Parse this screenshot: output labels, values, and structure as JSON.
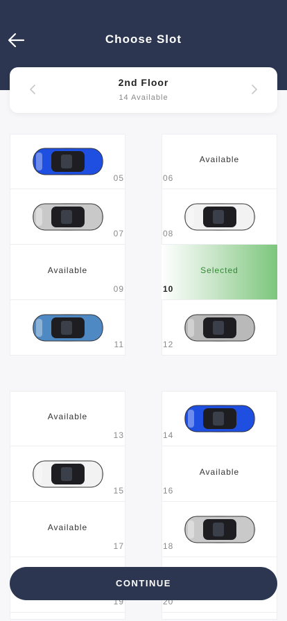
{
  "header": {
    "title": "Choose Slot"
  },
  "floor": {
    "name": "2nd Floor",
    "available": "14 Available"
  },
  "slots": [
    {
      "num": "05",
      "state": "car",
      "color": "#1f4fe0"
    },
    {
      "num": "06",
      "state": "available",
      "label": "Available"
    },
    {
      "num": "07",
      "state": "car",
      "color": "#c9c9c9"
    },
    {
      "num": "08",
      "state": "car",
      "color": "#f2f2f2"
    },
    {
      "num": "09",
      "state": "available",
      "label": "Available"
    },
    {
      "num": "10",
      "state": "selected",
      "label": "Selected"
    },
    {
      "num": "11",
      "state": "car",
      "color": "#4f89c4"
    },
    {
      "num": "12",
      "state": "car",
      "color": "#b9b9b9"
    },
    {
      "num": "13",
      "state": "available",
      "label": "Available"
    },
    {
      "num": "14",
      "state": "car",
      "color": "#1f4fe0"
    },
    {
      "num": "15",
      "state": "car",
      "color": "#f2f2f2"
    },
    {
      "num": "16",
      "state": "available",
      "label": "Available"
    },
    {
      "num": "17",
      "state": "available",
      "label": "Available"
    },
    {
      "num": "18",
      "state": "car",
      "color": "#c9c9c9"
    },
    {
      "num": "19",
      "state": "empty"
    },
    {
      "num": "20",
      "state": "empty"
    }
  ],
  "continue_label": "CONTINUE",
  "colors": {
    "header": "#2c3651",
    "selected": "#7cc67c"
  }
}
